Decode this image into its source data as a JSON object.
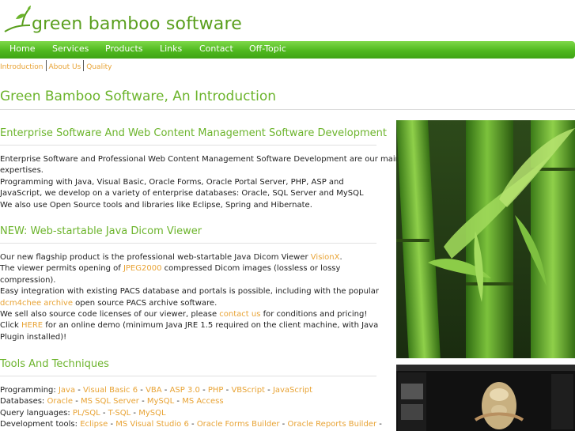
{
  "header": {
    "logo_text": "green bamboo software",
    "logo_icon": "bamboo-sprout-icon"
  },
  "nav": {
    "items": [
      "Home",
      "Services",
      "Products",
      "Links",
      "Contact",
      "Off-Topic"
    ]
  },
  "subnav": {
    "items": [
      "Introduction",
      "About Us",
      "Quality"
    ]
  },
  "page_title": "Green Bamboo Software, An Introduction",
  "sections": {
    "enterprise": {
      "heading": "Enterprise Software And Web Content Management Software Development",
      "lines": [
        "Enterprise Software and Professional Web Content Management Software Development are our main",
        "expertises.",
        "Programming with Java, Visual Basic, Oracle Forms, Oracle Portal Server, PHP, ASP and",
        "JavaScript, we develop on a variety of enterprise databases: Oracle, SQL Server and MySQL",
        "We also use Open Source tools and libraries like Eclipse, Spring and Hibernate."
      ]
    },
    "dicom": {
      "heading": "NEW: Web-startable Java Dicom Viewer",
      "l1_a": "Our new flagship product is the professional web-startable Java Dicom Viewer ",
      "l1_link": "VisionX",
      "l1_b": ".",
      "l2_a": "The viewer permits opening of ",
      "l2_link": "JPEG2000",
      "l2_b": " compressed Dicom images (lossless or lossy",
      "l3": "compression).",
      "l4": "Easy integration with existing PACS database and portals is possible, including with the popular",
      "l5_link": "dcm4chee archive",
      "l5_b": " open source PACS archive software.",
      "l6_a": "We sell also source code licenses of our viewer, please ",
      "l6_link": "contact us",
      "l6_b": " for conditions and pricing!",
      "l7_a": "Click ",
      "l7_link": "HERE",
      "l7_b": " for an online demo (minimum Java JRE 1.5 required on the client machine, with Java",
      "l8": "Plugin installed)!"
    },
    "tools": {
      "heading": "Tools And Techniques",
      "rows": [
        {
          "label": "Programming: ",
          "items": [
            "Java",
            "Visual Basic 6",
            "VBA",
            "ASP 3.0",
            "PHP",
            "VBScript",
            "JavaScript"
          ]
        },
        {
          "label": "Databases: ",
          "items": [
            "Oracle",
            "MS SQL Server",
            "MySQL",
            "MS Access"
          ]
        },
        {
          "label": "Query languages: ",
          "items": [
            "PL/SQL",
            "T-SQL",
            "MySQL"
          ]
        },
        {
          "label": "Development tools: ",
          "items": [
            "Eclipse",
            "MS Visual Studio 6",
            "Oracle Forms Builder",
            "Oracle Reports Builder"
          ],
          "trailing": " -"
        }
      ]
    }
  },
  "colors": {
    "brand_green": "#5a9f1e",
    "heading_green": "#6cb42c",
    "nav_green": "#4fb81e",
    "link_orange": "#e8a335"
  }
}
